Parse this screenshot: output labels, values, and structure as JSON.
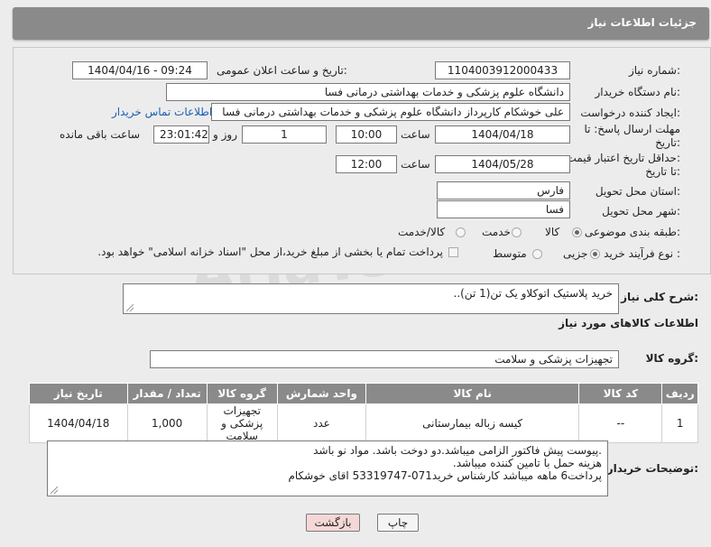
{
  "header": {
    "title": "جزئیات اطلاعات نیاز"
  },
  "form": {
    "need_number_label": "شماره نیاز:",
    "need_number": "1104003912000433",
    "announce_label": "تاریخ و ساعت اعلان عمومی:",
    "announce_value": "1404/04/16 - 09:24",
    "buyer_org_label": "نام دستگاه خریدار:",
    "buyer_org": "دانشگاه علوم پزشکی و خدمات بهداشتی درمانی فسا",
    "requester_label": "ایجاد کننده درخواست:",
    "requester": "علی خوشکام کارپرداز دانشگاه علوم پزشکی و خدمات بهداشتی درمانی فسا",
    "contact_link": "اطلاعات تماس خریدار",
    "deadline_label_1": "مهلت ارسال پاسخ: تا",
    "deadline_label_2": "تاریخ:",
    "deadline_date": "1404/04/18",
    "time_label": "ساعت",
    "deadline_time": "10:00",
    "days_value": "1",
    "days_label": "روز و",
    "remaining_time": "23:01:42",
    "remaining_label": "ساعت باقی مانده",
    "validity_label_1": "حداقل تاریخ اعتبار قیمت:",
    "validity_label_2": "تا تاریخ:",
    "validity_date": "1404/05/28",
    "validity_time": "12:00",
    "province_label": "استان محل تحویل:",
    "province": "فارس",
    "city_label": "شهر محل تحویل:",
    "city": "فسا",
    "category_label": "طبقه بندی موضوعی:",
    "category_options": [
      "کالا",
      "خدمت",
      "کالا/خدمت"
    ],
    "purchase_type_label": "نوع فرآیند خرید :",
    "purchase_options": [
      "جزیی",
      "متوسط"
    ],
    "payment_note": "پرداخت تمام یا بخشی از مبلغ خرید،از محل \"اسناد خزانه اسلامی\" خواهد بود."
  },
  "description": {
    "label": "شرح کلی نیاز:",
    "text": "خرید پلاستیک اتوکلاو  یک تن(1 تن).."
  },
  "goods": {
    "section_title": "اطلاعات کالاهای مورد نیاز",
    "group_label": "گروه کالا:",
    "group_value": "تجهیزات پزشکی و سلامت",
    "columns": [
      "ردیف",
      "کد کالا",
      "نام کالا",
      "واحد شمارش",
      "گروه کالا",
      "تعداد / مقدار",
      "تاریخ نیاز"
    ],
    "rows": [
      {
        "row": "1",
        "code": "--",
        "name": "کیسه زباله بیمارستانی",
        "unit": "عدد",
        "group": "تجهیزات پزشکی و سلامت",
        "qty": "1,000",
        "date": "1404/04/18"
      }
    ]
  },
  "buyer_notes": {
    "label": "توضیحات خریدار:",
    "lines": [
      ".پیوست پیش فاکتور الزامی میباشد.دو دوخت باشد. مواد نو باشد",
      "هزینه حمل با تامین کننده میباشد.",
      "پرداخت6 ماهه میباشد کارشناس خرید071-53319747 اقای خوشکام"
    ]
  },
  "buttons": {
    "print": "چاپ",
    "back": "بازگشت"
  },
  "watermark": "AriaTender.neT",
  "colors": {
    "header_bg": "#8a8a8a",
    "link": "#1a5fb4",
    "back_btn": "#f6d7d7"
  }
}
